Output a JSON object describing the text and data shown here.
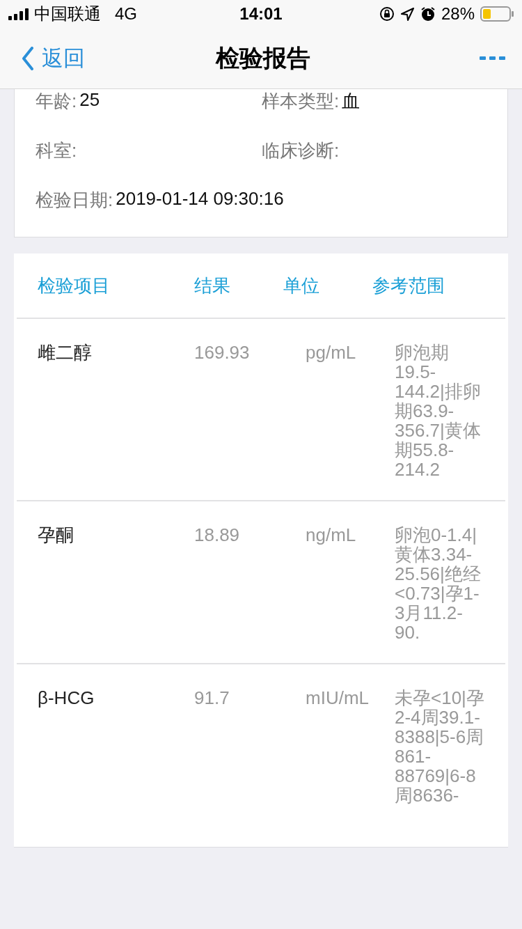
{
  "status_bar": {
    "carrier": "中国联通",
    "network": "4G",
    "time": "14:01",
    "battery": "28%"
  },
  "nav": {
    "back": "返回",
    "title": "检验报告"
  },
  "info": [
    {
      "label": "年龄:",
      "value": "25"
    },
    {
      "label": "样本类型:",
      "value": "血"
    },
    {
      "label": "科室:"
    },
    {
      "label": "临床诊断:"
    },
    {
      "label": "检验日期:",
      "value": "2019-01-14 09:30:16"
    }
  ],
  "table": {
    "columns": [
      "检验项目",
      "结果",
      "单位",
      "参考范围"
    ],
    "rows": [
      {
        "item": "雌二醇",
        "result": "169.93",
        "unit": "pg/mL",
        "range": "卵泡期19.5-144.2|排卵期63.9-356.7|黄体期55.8-214.2"
      },
      {
        "item": "孕酮",
        "result": "18.89",
        "unit": "ng/mL",
        "range": "卵泡0-1.4|黄体3.34-25.56|绝经<0.73|孕1-3月11.2-90."
      },
      {
        "item": "β-HCG",
        "result": "91.7",
        "unit": "mIU/mL",
        "range": "未孕<10|孕2-4周39.1-8388|5-6周861-88769|6-8周8636-"
      }
    ]
  }
}
